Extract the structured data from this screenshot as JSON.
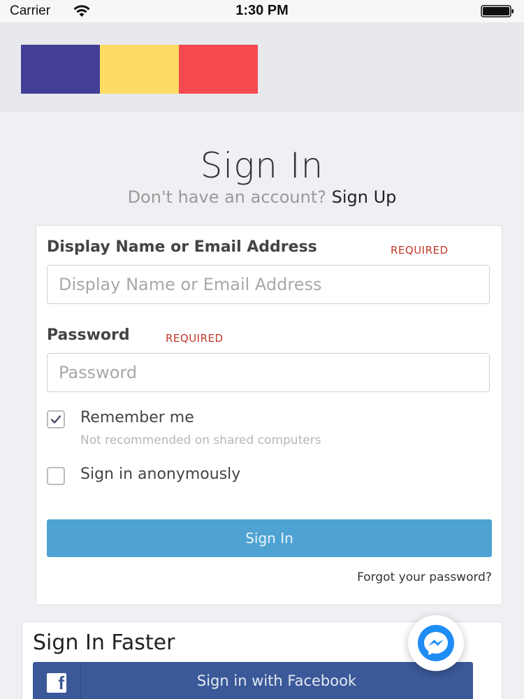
{
  "status_bar": {
    "carrier": "Carrier",
    "time": "1:30 PM"
  },
  "logo": {
    "colors": [
      "#433f96",
      "#fddc64",
      "#f64a50"
    ]
  },
  "page": {
    "title": "Sign In",
    "subtitle_prefix": "Don't have an account?",
    "signup_link": "Sign Up"
  },
  "form": {
    "username": {
      "label": "Display Name or Email Address",
      "required": "REQUIRED",
      "placeholder": "Display Name or Email Address",
      "value": ""
    },
    "password": {
      "label": "Password",
      "required": "REQUIRED",
      "placeholder": "Password",
      "value": ""
    },
    "remember_me": {
      "label": "Remember me",
      "hint": "Not recommended on shared computers",
      "checked": true
    },
    "anonymous": {
      "label": "Sign in anonymously",
      "checked": false
    },
    "submit_label": "Sign In",
    "forgot_link": "Forgot your password?"
  },
  "faster": {
    "title": "Sign In Faster",
    "facebook_label": "Sign in with Facebook"
  },
  "icons": {
    "wifi": "wifi-icon",
    "battery": "battery-icon",
    "check": "check-icon",
    "facebook": "facebook-icon",
    "messenger": "messenger-icon"
  },
  "colors": {
    "primary_button": "#4fa3d3",
    "facebook": "#3b5998",
    "required": "#c0392b",
    "messenger": "#1e8cf5"
  }
}
